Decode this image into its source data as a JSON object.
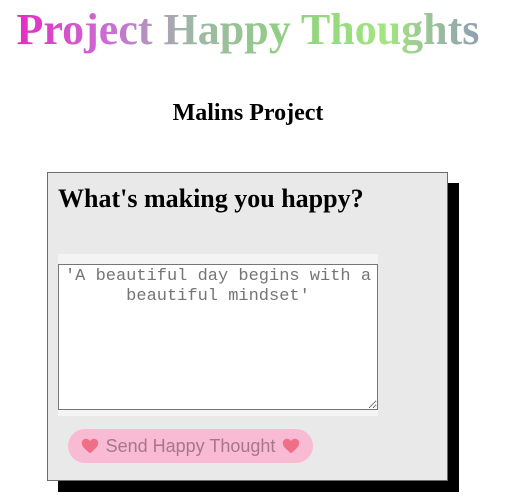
{
  "header": {
    "title": "Project Happy Thoughts",
    "subtitle": "Malins Project"
  },
  "form": {
    "heading": "What's making you happy?",
    "input_value": "",
    "input_placeholder": "'A beautiful day begins with a beautiful mindset'",
    "button_label": "Send Happy Thought",
    "button_icon": "heart-icon"
  },
  "colors": {
    "heart": "#ef6f86",
    "button_bg": "#f8bbd3",
    "card_bg": "#e9e9e9",
    "shadow": "#000000"
  }
}
